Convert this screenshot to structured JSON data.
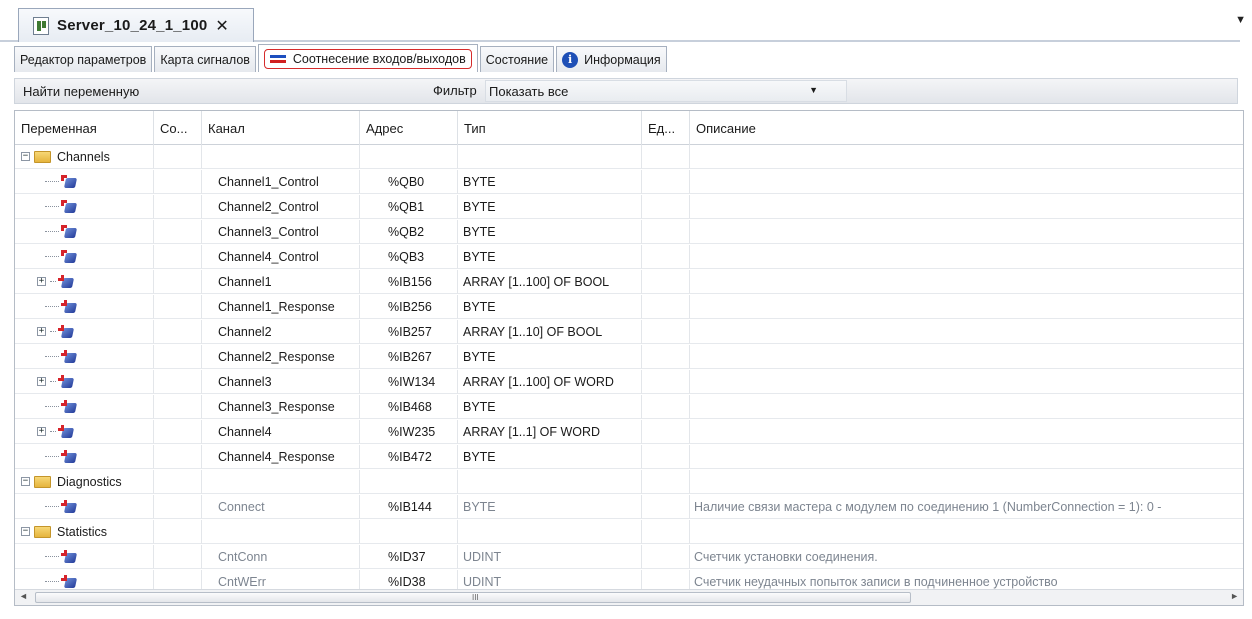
{
  "document_tab": {
    "title": "Server_10_24_1_100",
    "close": "✕",
    "dropdown": "▼"
  },
  "tabs": [
    {
      "label": "Редактор параметров"
    },
    {
      "label": "Карта сигналов"
    },
    {
      "label": "Соотнесение входов/выходов",
      "active": true
    },
    {
      "label": "Состояние"
    },
    {
      "label": "Информация"
    }
  ],
  "toolbar": {
    "find_label": "Найти переменную",
    "filter_label": "Фильтр",
    "filter_value": "Показать все"
  },
  "columns": {
    "variable": "Переменная",
    "co": "Со...",
    "channel": "Канал",
    "address": "Адрес",
    "type": "Тип",
    "unit": "Ед...",
    "description": "Описание"
  },
  "rows": [
    {
      "kind": "folder",
      "name": "Channels"
    },
    {
      "kind": "var",
      "dir": "out",
      "channel": "Channel1_Control",
      "address": "%QB0",
      "type": "BYTE",
      "description": ""
    },
    {
      "kind": "var",
      "dir": "out",
      "channel": "Channel2_Control",
      "address": "%QB1",
      "type": "BYTE",
      "description": ""
    },
    {
      "kind": "var",
      "dir": "out",
      "channel": "Channel3_Control",
      "address": "%QB2",
      "type": "BYTE",
      "description": ""
    },
    {
      "kind": "var",
      "dir": "out",
      "channel": "Channel4_Control",
      "address": "%QB3",
      "type": "BYTE",
      "description": ""
    },
    {
      "kind": "var",
      "dir": "in",
      "expand": true,
      "channel": "Channel1",
      "address": "%IB156",
      "type": "ARRAY [1..100] OF BOOL",
      "description": ""
    },
    {
      "kind": "var",
      "dir": "in",
      "channel": "Channel1_Response",
      "address": "%IB256",
      "type": "BYTE",
      "description": ""
    },
    {
      "kind": "var",
      "dir": "in",
      "expand": true,
      "channel": "Channel2",
      "address": "%IB257",
      "type": "ARRAY [1..10] OF BOOL",
      "description": ""
    },
    {
      "kind": "var",
      "dir": "in",
      "channel": "Channel2_Response",
      "address": "%IB267",
      "type": "BYTE",
      "description": ""
    },
    {
      "kind": "var",
      "dir": "in",
      "expand": true,
      "channel": "Channel3",
      "address": "%IW134",
      "type": "ARRAY [1..100] OF WORD",
      "description": ""
    },
    {
      "kind": "var",
      "dir": "in",
      "channel": "Channel3_Response",
      "address": "%IB468",
      "type": "BYTE",
      "description": ""
    },
    {
      "kind": "var",
      "dir": "in",
      "expand": true,
      "channel": "Channel4",
      "address": "%IW235",
      "type": "ARRAY [1..1] OF WORD",
      "description": ""
    },
    {
      "kind": "var",
      "dir": "in",
      "channel": "Channel4_Response",
      "address": "%IB472",
      "type": "BYTE",
      "description": ""
    },
    {
      "kind": "folder",
      "name": "Diagnostics"
    },
    {
      "kind": "var",
      "dir": "in",
      "muted": true,
      "channel": "Connect",
      "address": "%IB144",
      "type": "BYTE",
      "description": "Наличие связи мастера с модулем по соединению 1 (NumberConnection = 1): 0 -"
    },
    {
      "kind": "folder",
      "name": "Statistics"
    },
    {
      "kind": "var",
      "dir": "in",
      "muted": true,
      "channel": "CntConn",
      "address": "%ID37",
      "type": "UDINT",
      "description": "Счетчик установки соединения."
    },
    {
      "kind": "var",
      "dir": "in",
      "muted": true,
      "channel": "CntWErr",
      "address": "%ID38",
      "type": "UDINT",
      "description": "Счетчик неудачных попыток записи в подчиненное устройство"
    }
  ],
  "scrollbar": {
    "grip": "III",
    "left": "◄",
    "right": "►"
  }
}
